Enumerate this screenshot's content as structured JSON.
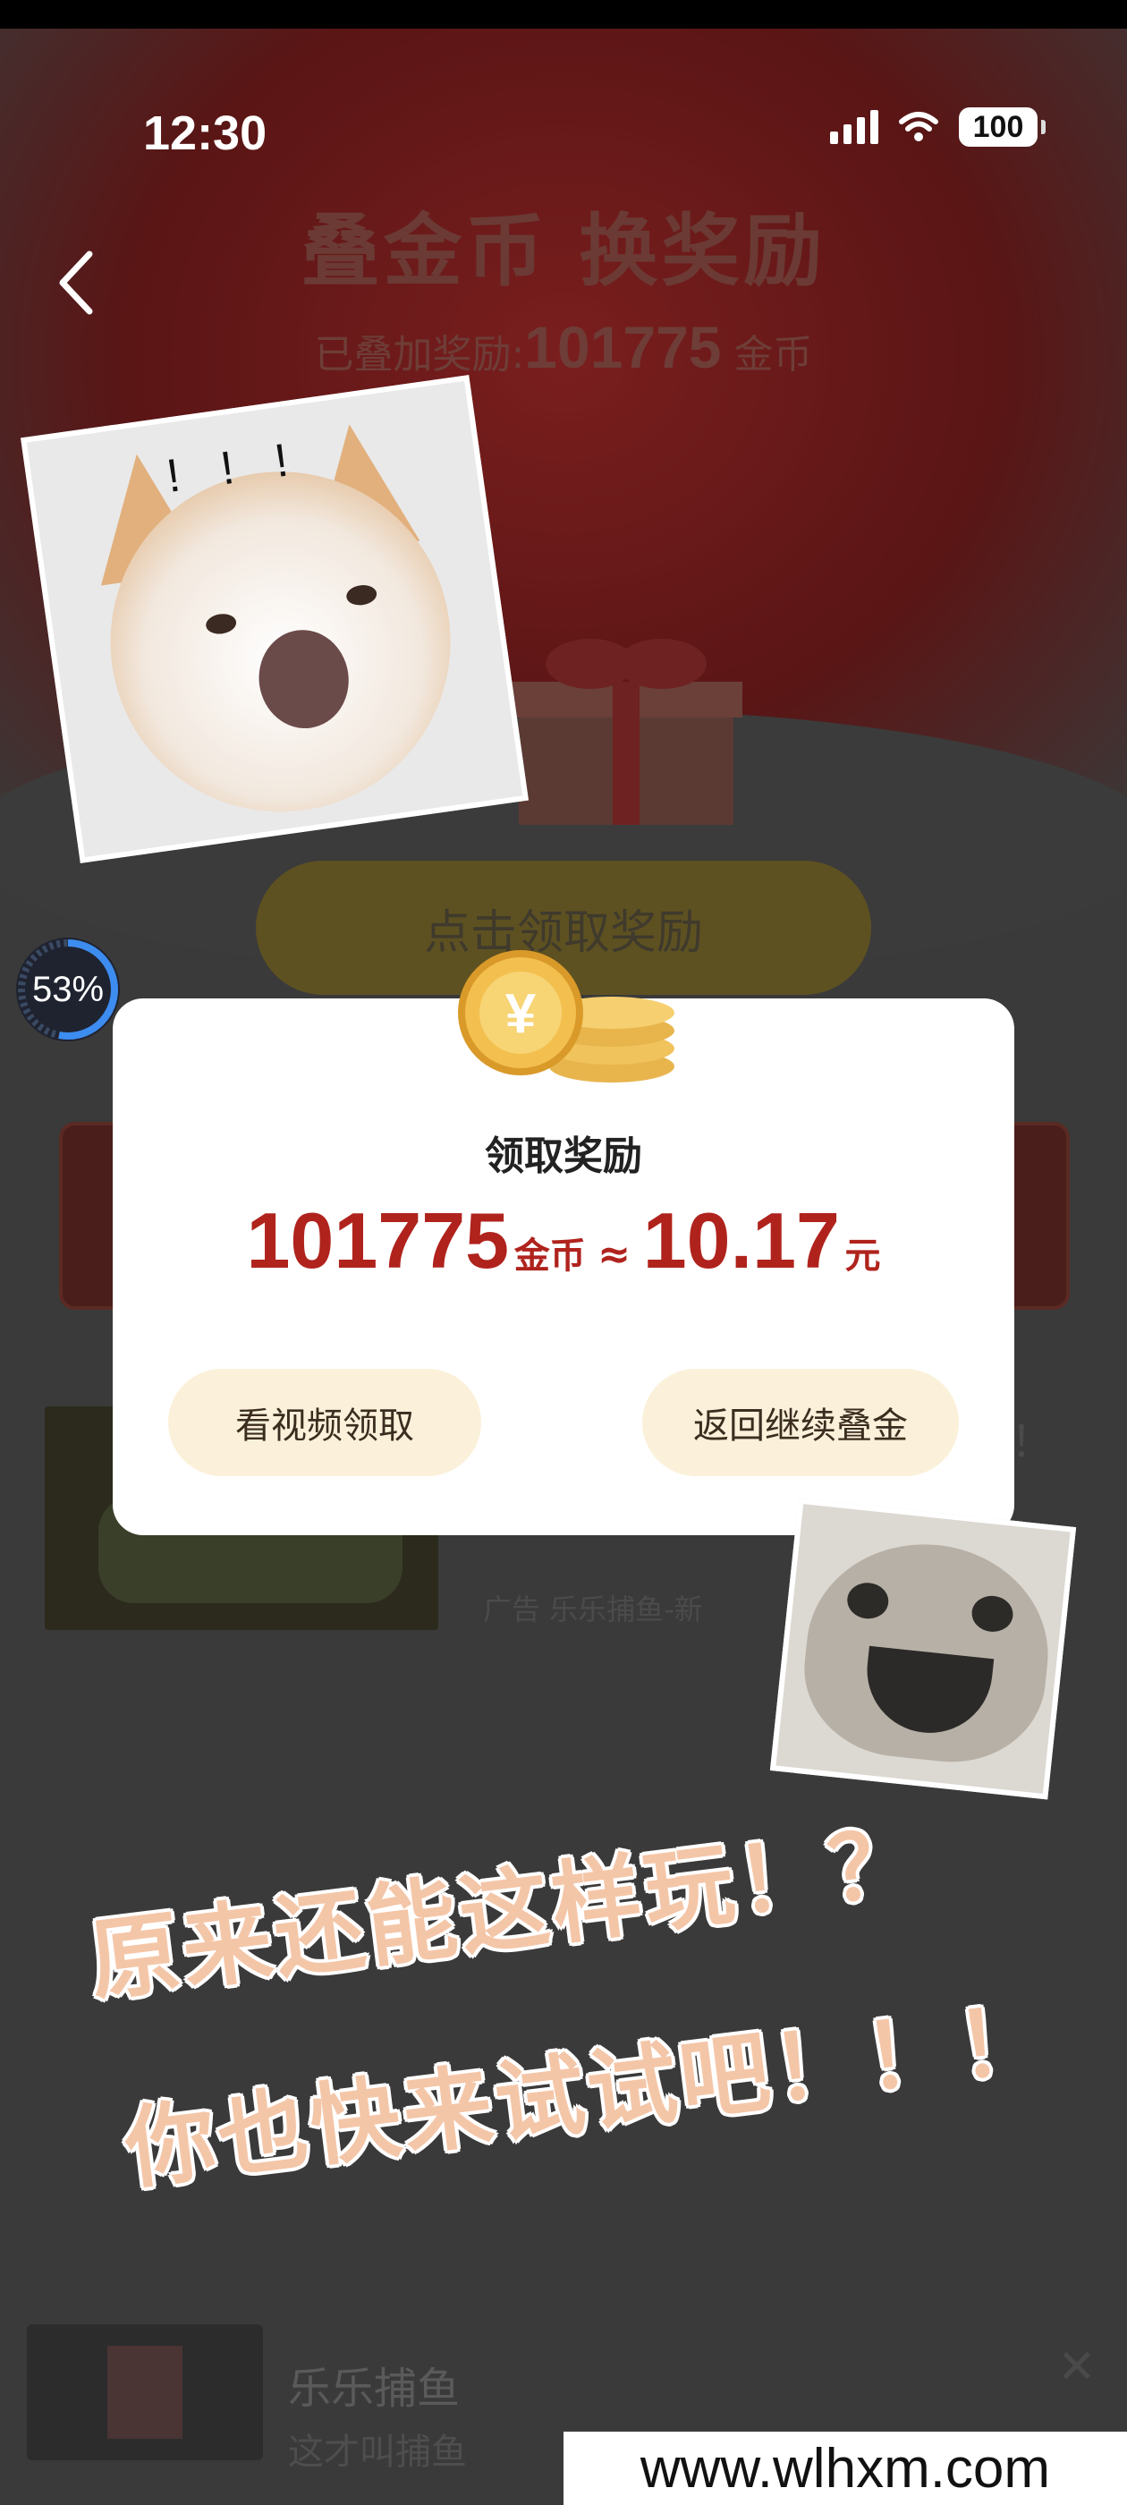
{
  "status": {
    "time": "12:30",
    "battery": "100"
  },
  "hero": {
    "title": "叠金币 换奖励",
    "sub_prefix": "已叠加奖励:",
    "sub_value": "101775",
    "sub_unit": "金币"
  },
  "claim_button": "点击领取奖励",
  "progress": {
    "text": "53%",
    "value": 0.53
  },
  "modal": {
    "title": "领取奖励",
    "coins": "101775",
    "coins_unit": "金币",
    "approx": "≈",
    "cash": "10.17",
    "cash_unit": "元",
    "watch_button": "看视频领取",
    "back_button": "返回继续叠金"
  },
  "ad": {
    "label": "广告  乐乐捕鱼-新",
    "side_text": "！"
  },
  "bottom_banner": {
    "title": "乐乐捕鱼",
    "subtitle": "这才叫捕鱼",
    "close": "✕"
  },
  "stickers": {
    "cat_text": "! ! !"
  },
  "caption": {
    "line1": "原来还能这样玩！？",
    "line2": "你也快来试试吧！！！"
  },
  "watermark": "www.wlhxm.com",
  "colors": {
    "accent_red": "#b0231d",
    "pill_bg": "#fbf1da",
    "caption": "#f4c6a8"
  }
}
